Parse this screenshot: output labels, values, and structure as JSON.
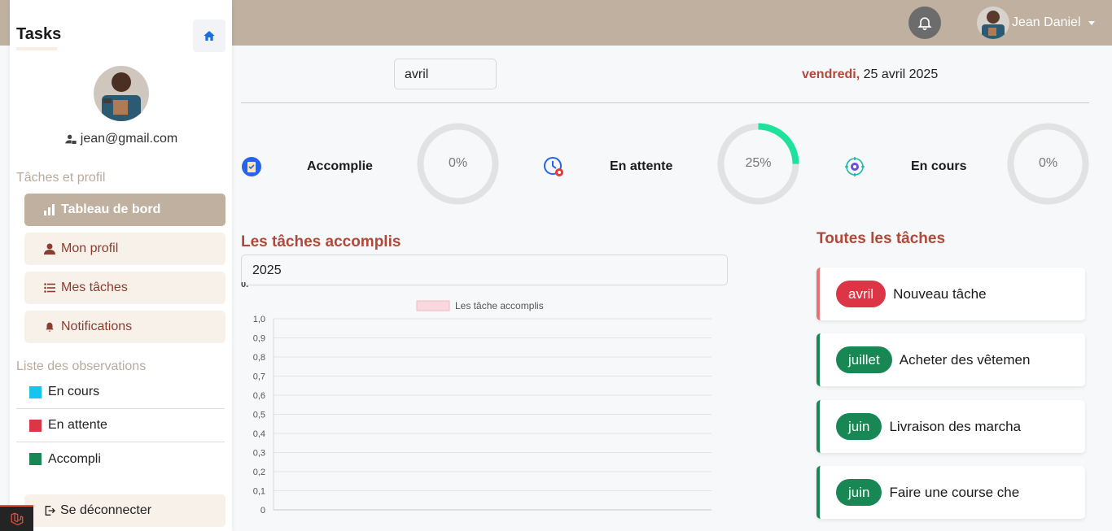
{
  "header": {
    "user_name": "Jean Daniel",
    "bell_icon": "bell-icon",
    "user_avatar": "avatar-photo"
  },
  "sidebar": {
    "brand": "Tasks",
    "home_icon": "home-icon",
    "email": "jean@gmail.com",
    "section_label": "Tâches et profil",
    "items": [
      {
        "label": "Tableau de bord",
        "icon": "bar-chart-icon",
        "active": true
      },
      {
        "label": "Mon profil",
        "icon": "user-icon"
      },
      {
        "label": "Mes tâches",
        "icon": "list-icon"
      },
      {
        "label": "Notifications",
        "icon": "bell-icon"
      }
    ],
    "observations_label": "Liste des observations",
    "legend": [
      {
        "label": "En cours",
        "color": "#17c4f0"
      },
      {
        "label": "En attente",
        "color": "#dc3545"
      },
      {
        "label": "Accompli",
        "color": "#198754"
      }
    ],
    "logout_label": "Se déconnecter"
  },
  "filters": {
    "month": "avril",
    "date_day": "vendredi,",
    "date_rest": "25 avril 2025"
  },
  "stats": [
    {
      "label": "Accomplie",
      "percent_text": "0%",
      "value": 0,
      "icon": "clipboard-check-icon",
      "color": "#2ecc9a"
    },
    {
      "label": "En attente",
      "percent_text": "25%",
      "value": 25,
      "icon": "clock-alert-icon",
      "color": "#1de29b"
    },
    {
      "label": "En cours",
      "percent_text": "0%",
      "value": 0,
      "icon": "gear-target-icon",
      "color": "#1de29b"
    }
  ],
  "chart_section": {
    "title": "Les tâches accomplis",
    "year": "2025",
    "clipped_label": "0,"
  },
  "chart_data": {
    "type": "bar",
    "title": "",
    "legend": "Les tâche accomplis",
    "categories": [],
    "series": [
      {
        "name": "Les tâche accomplis",
        "values": []
      }
    ],
    "yticks": [
      "0",
      "0,1",
      "0,2",
      "0,3",
      "0,4",
      "0,5",
      "0,6",
      "0,7",
      "0,8",
      "0,9",
      "1,0"
    ],
    "ylim": [
      0,
      1
    ],
    "grid": true,
    "legend_position": "top"
  },
  "tasks_section": {
    "title": "Toutes les tâches",
    "items": [
      {
        "month": "avril",
        "title": "Nouveau tâche",
        "pill_color": "#dc3545",
        "border_color": "#e57373"
      },
      {
        "month": "juillet",
        "title": "Acheter des vêtemen",
        "pill_color": "#198754",
        "border_color": "#198754"
      },
      {
        "month": "juin",
        "title": "Livraison des marcha",
        "pill_color": "#198754",
        "border_color": "#198754"
      },
      {
        "month": "juin",
        "title": "Faire une course che",
        "pill_color": "#198754",
        "border_color": "#198754"
      }
    ]
  }
}
